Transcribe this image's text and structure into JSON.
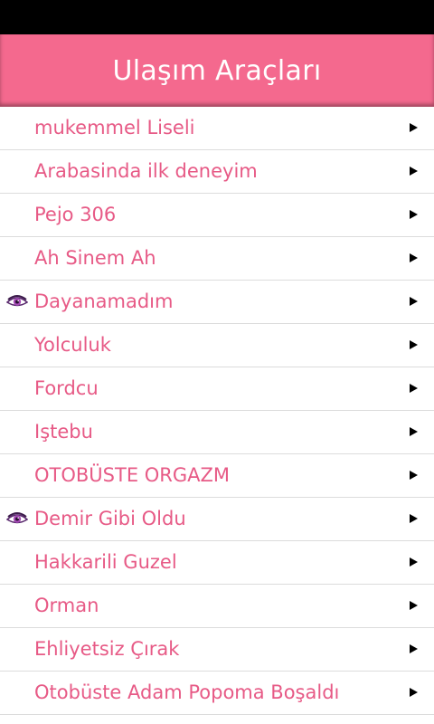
{
  "header": {
    "title": "Ulaşım Araçları"
  },
  "colors": {
    "accent": "#f4698e",
    "item_text": "#e75a86",
    "status_bar": "#000000"
  },
  "list": {
    "items": [
      {
        "label": "mukemmel Liseli",
        "icon": null
      },
      {
        "label": "Arabasinda ilk deneyim",
        "icon": null
      },
      {
        "label": "Pejo 306",
        "icon": null
      },
      {
        "label": "Ah Sinem Ah",
        "icon": null
      },
      {
        "label": "Dayanamadım",
        "icon": "eye-icon"
      },
      {
        "label": "Yolculuk",
        "icon": null
      },
      {
        "label": "Fordcu",
        "icon": null
      },
      {
        "label": "Iştebu",
        "icon": null
      },
      {
        "label": "OTOBÜSTE ORGAZM",
        "icon": null
      },
      {
        "label": "Demir Gibi Oldu",
        "icon": "eye-icon"
      },
      {
        "label": "Hakkarili Guzel",
        "icon": null
      },
      {
        "label": "Orman",
        "icon": null
      },
      {
        "label": "Ehliyetsiz Çırak",
        "icon": null
      },
      {
        "label": "Otobüste Adam Popoma Boşaldı",
        "icon": null
      }
    ]
  }
}
